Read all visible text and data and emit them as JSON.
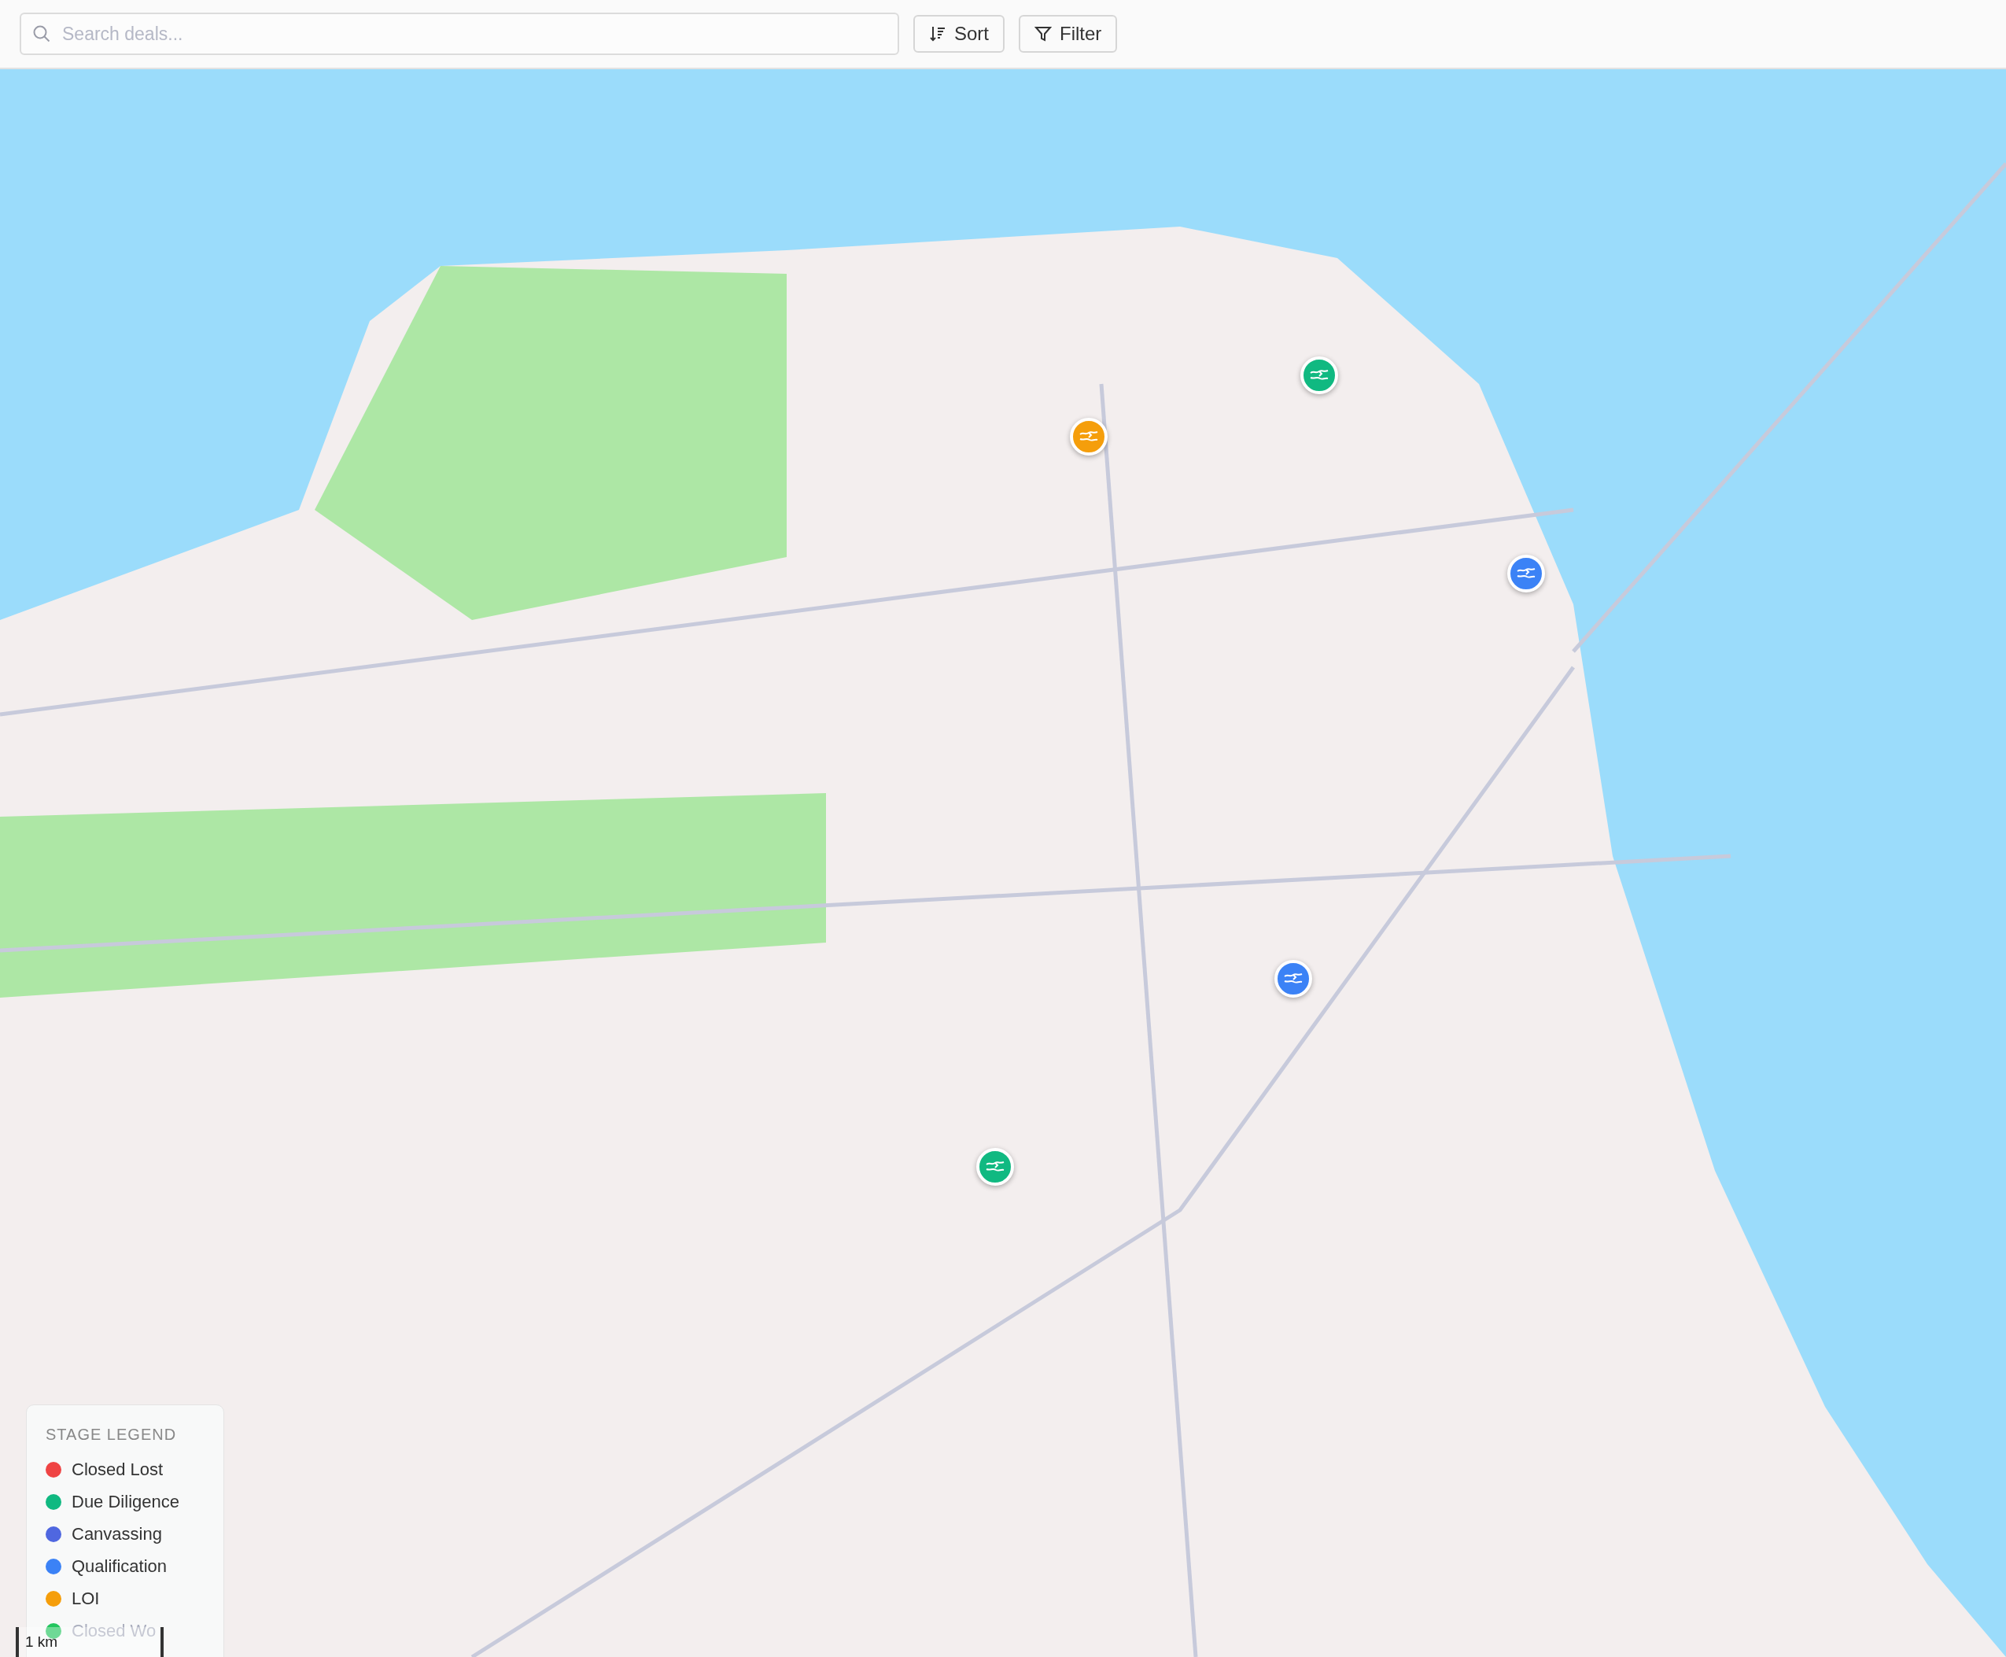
{
  "toolbar": {
    "search": {
      "placeholder": "Search deals..."
    },
    "buttons": [
      {
        "kind": "sort",
        "label": "Sort"
      },
      {
        "kind": "filter",
        "label": "Filter"
      }
    ]
  },
  "map": {
    "markers": [
      {
        "color": "#10b981"
      },
      {
        "color": "#f59e0b"
      },
      {
        "color": "#3b82f6"
      },
      {
        "color": "#3b82f6"
      },
      {
        "color": "#10b981"
      }
    ],
    "legend": {
      "title": "STAGE LEGEND",
      "items": [
        {
          "label": "Closed Lost",
          "color": "#ef4444"
        },
        {
          "label": "Due Diligence",
          "color": "#10b981"
        },
        {
          "label": "Canvassing",
          "color": "#4f67e0"
        },
        {
          "label": "Qualification",
          "color": "#3b82f6"
        },
        {
          "label": "LOI",
          "color": "#f59e0b"
        },
        {
          "label": "Closed Wo",
          "color": "#22c55e"
        }
      ]
    },
    "scale": "1 km"
  }
}
